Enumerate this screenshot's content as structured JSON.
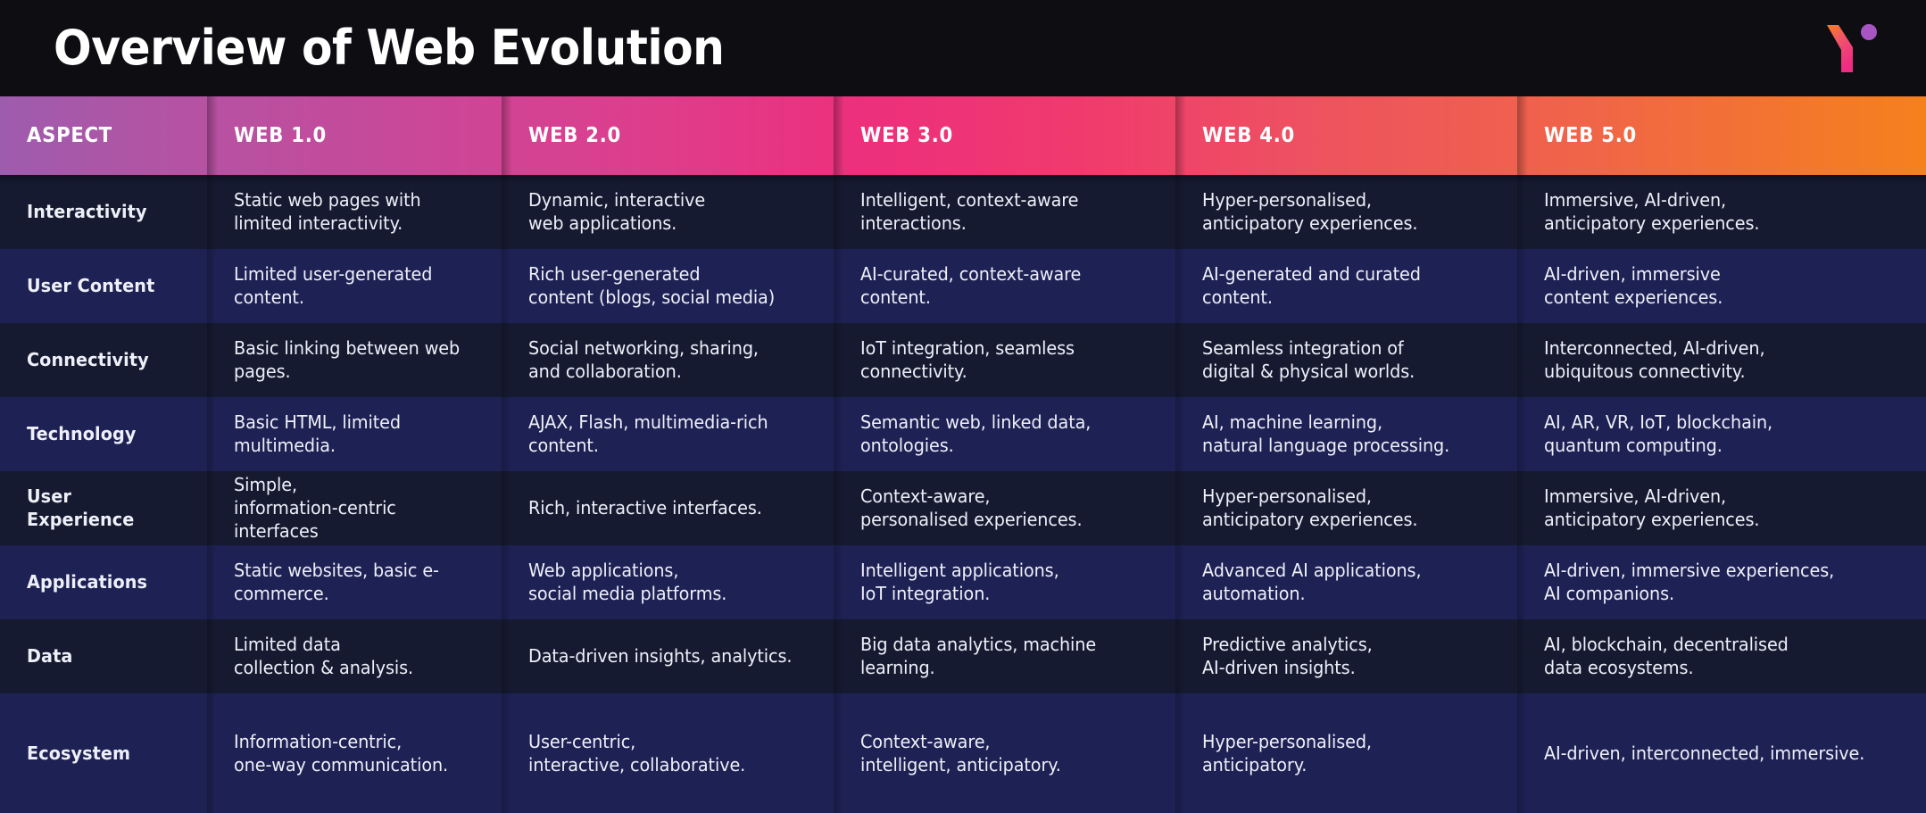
{
  "header": {
    "title": "Overview of Web Evolution",
    "logo_name": "brand-logo-y-mark"
  },
  "colors": {
    "title_bar_bg": "#0e0e12",
    "header_gradient_start": "#9e5cae",
    "header_gradient_mid": "#ed2f7c",
    "header_gradient_end": "#f5811d",
    "row_dark": "#161a31",
    "row_light": "#1e2153",
    "text": "#eef0f8",
    "logo_dot": "#a855c4",
    "logo_gradient_start": "#f5811d",
    "logo_gradient_end": "#ee2d82"
  },
  "table": {
    "columns": [
      "ASPECT",
      "WEB 1.0",
      "WEB 2.0",
      "WEB 3.0",
      "WEB 4.0",
      "WEB 5.0"
    ],
    "rows": [
      {
        "aspect": "Interactivity",
        "web1": "Static web pages with\nlimited interactivity.",
        "web2": "Dynamic, interactive\nweb applications.",
        "web3": "Intelligent, context-aware interactions.",
        "web4": "Hyper-personalised,\nanticipatory experiences.",
        "web5": "Immersive, AI-driven,\nanticipatory experiences."
      },
      {
        "aspect": "User Content",
        "web1": "Limited user-generated content.",
        "web2": "Rich user-generated\ncontent (blogs, social media)",
        "web3": "AI-curated, context-aware content.",
        "web4": "AI-generated and curated content.",
        "web5": "AI-driven, immersive\ncontent experiences."
      },
      {
        "aspect": "Connectivity",
        "web1": "Basic linking between web pages.",
        "web2": "Social networking, sharing,\nand collaboration.",
        "web3": "IoT integration, seamless connectivity.",
        "web4": "Seamless integration of\ndigital & physical worlds.",
        "web5": "Interconnected, AI-driven,\nubiquitous connectivity."
      },
      {
        "aspect": "Technology",
        "web1": "Basic HTML, limited multimedia.",
        "web2": "AJAX, Flash, multimedia-rich content.",
        "web3": "Semantic web, linked data, ontologies.",
        "web4": "AI, machine learning,\nnatural language processing.",
        "web5": "AI, AR, VR, IoT, blockchain,\nquantum computing."
      },
      {
        "aspect": "User Experience",
        "web1": "Simple,\ninformation-centric\ninterfaces",
        "web2": "Rich, interactive interfaces.",
        "web3": "Context-aware,\npersonalised experiences.",
        "web4": "Hyper-personalised,\nanticipatory experiences.",
        "web5": "Immersive, AI-driven,\nanticipatory experiences."
      },
      {
        "aspect": "Applications",
        "web1": "Static websites, basic e-commerce.",
        "web2": "Web applications,\nsocial media platforms.",
        "web3": "Intelligent applications,\nIoT integration.",
        "web4": "Advanced AI applications, automation.",
        "web5": "AI-driven, immersive experiences,\nAI companions."
      },
      {
        "aspect": "Data",
        "web1": "Limited data\ncollection & analysis.",
        "web2": "Data-driven insights, analytics.",
        "web3": "Big data analytics, machine learning.",
        "web4": "Predictive analytics,\nAI-driven insights.",
        "web5": "AI, blockchain, decentralised\ndata ecosystems."
      },
      {
        "aspect": "Ecosystem",
        "web1": "Information-centric,\none-way communication.",
        "web2": "User-centric,\ninteractive, collaborative.",
        "web3": "Context-aware,\nintelligent, anticipatory.",
        "web4": "Hyper-personalised,\nanticipatory.",
        "web5": "AI-driven, interconnected, immersive."
      }
    ]
  }
}
